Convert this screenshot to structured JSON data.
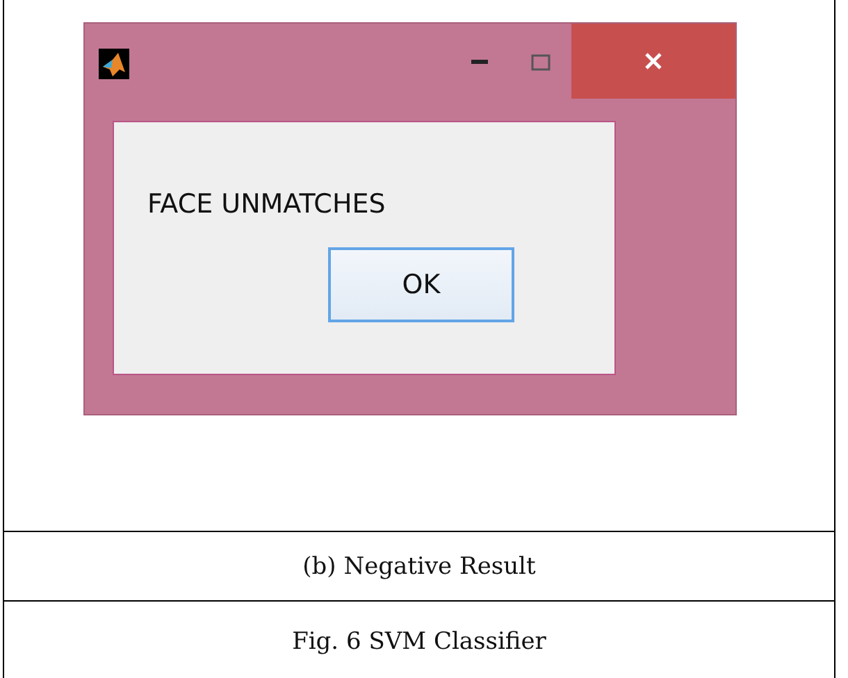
{
  "dialog": {
    "message": "FACE UNMATCHES",
    "button": "OK"
  },
  "subcaption": "(b) Negative Result",
  "caption": "Fig. 6 SVM Classifier"
}
